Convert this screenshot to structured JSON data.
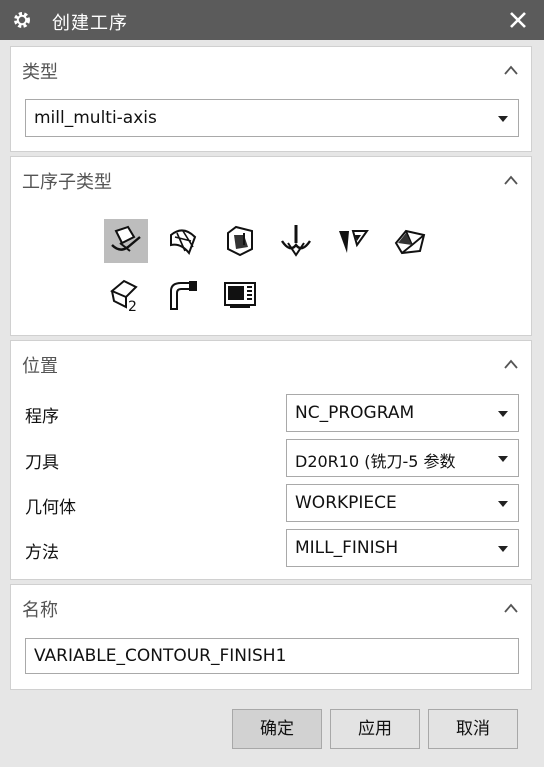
{
  "window": {
    "title": "创建工序",
    "icon": "gear-icon",
    "close_icon": "close-icon"
  },
  "type_panel": {
    "title": "类型",
    "select_value": "mill_multi-axis"
  },
  "subtype_panel": {
    "title": "工序子类型",
    "icons": [
      "variable-contour-icon",
      "variable-streamline-icon",
      "contour-profile-icon",
      "fixed-contour-icon",
      "multi-blade-icon",
      "flow-cut-icon",
      "multi-axis-drill-icon",
      "tube-rough-icon",
      "user-defined-icon"
    ]
  },
  "location_panel": {
    "title": "位置",
    "rows": [
      {
        "label": "程序",
        "value": "NC_PROGRAM"
      },
      {
        "label": "刀具",
        "value": "D20R10 (铣刀-5 参数"
      },
      {
        "label": "几何体",
        "value": "WORKPIECE"
      },
      {
        "label": "方法",
        "value": "MILL_FINISH"
      }
    ]
  },
  "name_panel": {
    "title": "名称",
    "value": "VARIABLE_CONTOUR_FINISH1"
  },
  "buttons": {
    "ok": "确定",
    "apply": "应用",
    "cancel": "取消"
  }
}
